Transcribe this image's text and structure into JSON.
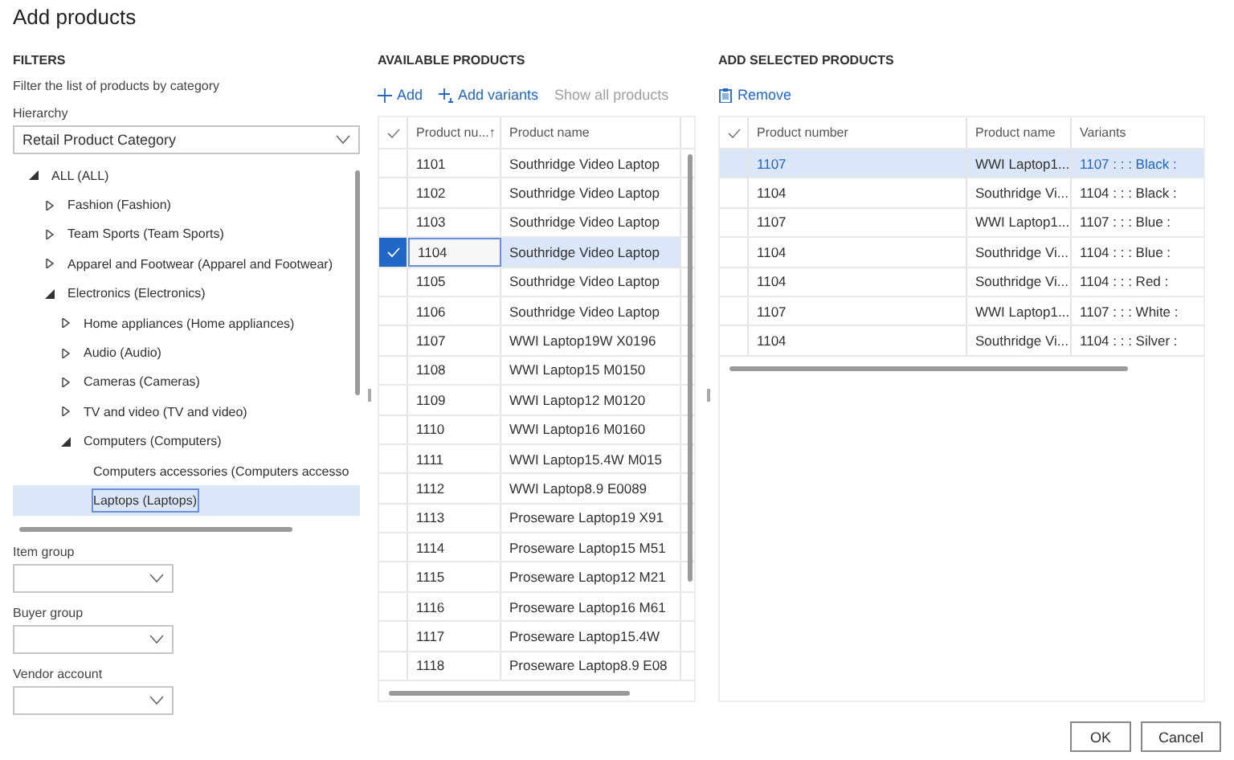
{
  "dialog": {
    "title": "Add products"
  },
  "filters": {
    "heading": "FILTERS",
    "description": "Filter the list of products by category",
    "hierarchy": {
      "label": "Hierarchy",
      "value": "Retail Product Category"
    },
    "tree": [
      {
        "label": "ALL (ALL)",
        "expanded": true,
        "selected": false,
        "children": [
          {
            "label": "Fashion (Fashion)",
            "expanded": false,
            "selected": false
          },
          {
            "label": "Team Sports (Team Sports)",
            "expanded": false,
            "selected": false
          },
          {
            "label": "Apparel and Footwear (Apparel and Footwear)",
            "expanded": false,
            "selected": false
          },
          {
            "label": "Electronics (Electronics)",
            "expanded": true,
            "selected": false,
            "children": [
              {
                "label": "Home appliances (Home appliances)",
                "expanded": false,
                "selected": false
              },
              {
                "label": "Audio (Audio)",
                "expanded": false,
                "selected": false
              },
              {
                "label": "Cameras (Cameras)",
                "expanded": false,
                "selected": false
              },
              {
                "label": "TV and video (TV and video)",
                "expanded": false,
                "selected": false
              },
              {
                "label": "Computers (Computers)",
                "expanded": true,
                "selected": false,
                "children": [
                  {
                    "label": "Computers accessories (Computers accesso",
                    "selected": false
                  },
                  {
                    "label": "Laptops (Laptops)",
                    "selected": true
                  }
                ]
              }
            ]
          }
        ]
      }
    ],
    "fields": [
      {
        "label": "Item group"
      },
      {
        "label": "Buyer group"
      },
      {
        "label": "Vendor account"
      }
    ]
  },
  "available": {
    "heading": "AVAILABLE PRODUCTS",
    "actions": [
      {
        "label": "Add",
        "kind": "add",
        "disabled": false
      },
      {
        "label": "Add variants",
        "kind": "add-variants",
        "disabled": false
      },
      {
        "label": "Show all products",
        "kind": "plain",
        "disabled": true
      }
    ],
    "columns": [
      {
        "label": "Product nu...",
        "sort_indicator": "↑"
      },
      {
        "label": "Product name"
      }
    ],
    "rows": [
      {
        "number": "1101",
        "name": "Southridge Video Laptop",
        "selected": false
      },
      {
        "number": "1102",
        "name": "Southridge Video Laptop",
        "selected": false
      },
      {
        "number": "1103",
        "name": "Southridge Video Laptop",
        "selected": false
      },
      {
        "number": "1104",
        "name": "Southridge Video Laptop",
        "selected": true
      },
      {
        "number": "1105",
        "name": "Southridge Video Laptop",
        "selected": false
      },
      {
        "number": "1106",
        "name": "Southridge Video Laptop",
        "selected": false
      },
      {
        "number": "1107",
        "name": "WWI Laptop19W X0196",
        "selected": false
      },
      {
        "number": "1108",
        "name": "WWI Laptop15 M0150",
        "selected": false
      },
      {
        "number": "1109",
        "name": "WWI Laptop12 M0120",
        "selected": false
      },
      {
        "number": "1110",
        "name": "WWI Laptop16 M0160",
        "selected": false
      },
      {
        "number": "1111",
        "name": "WWI Laptop15.4W M015",
        "selected": false
      },
      {
        "number": "1112",
        "name": "WWI Laptop8.9 E0089",
        "selected": false
      },
      {
        "number": "1113",
        "name": "Proseware Laptop19 X91",
        "selected": false
      },
      {
        "number": "1114",
        "name": "Proseware Laptop15 M51",
        "selected": false
      },
      {
        "number": "1115",
        "name": "Proseware Laptop12 M21",
        "selected": false
      },
      {
        "number": "1116",
        "name": "Proseware Laptop16 M61",
        "selected": false
      },
      {
        "number": "1117",
        "name": "Proseware Laptop15.4W",
        "selected": false
      },
      {
        "number": "1118",
        "name": "Proseware Laptop8.9 E08",
        "selected": false
      }
    ]
  },
  "selected_products": {
    "heading": "ADD SELECTED PRODUCTS",
    "actions": [
      {
        "label": "Remove",
        "kind": "remove",
        "disabled": false
      }
    ],
    "columns": [
      {
        "label": "Product number"
      },
      {
        "label": "Product name"
      },
      {
        "label": "Variants"
      }
    ],
    "rows": [
      {
        "number": "1107",
        "name": "WWI Laptop1...",
        "variants": "1107 : : : Black :",
        "selected": true
      },
      {
        "number": "1104",
        "name": "Southridge Vi...",
        "variants": "1104 : : : Black :",
        "selected": false
      },
      {
        "number": "1107",
        "name": "WWI Laptop1...",
        "variants": "1107 : : : Blue :",
        "selected": false
      },
      {
        "number": "1104",
        "name": "Southridge Vi...",
        "variants": "1104 : : : Blue :",
        "selected": false
      },
      {
        "number": "1104",
        "name": "Southridge Vi...",
        "variants": "1104 : : : Red :",
        "selected": false
      },
      {
        "number": "1107",
        "name": "WWI Laptop1...",
        "variants": "1107 : : : White :",
        "selected": false
      },
      {
        "number": "1104",
        "name": "Southridge Vi...",
        "variants": "1104 : : : Silver :",
        "selected": false
      }
    ]
  },
  "buttons": [
    {
      "label": "OK"
    },
    {
      "label": "Cancel"
    }
  ]
}
